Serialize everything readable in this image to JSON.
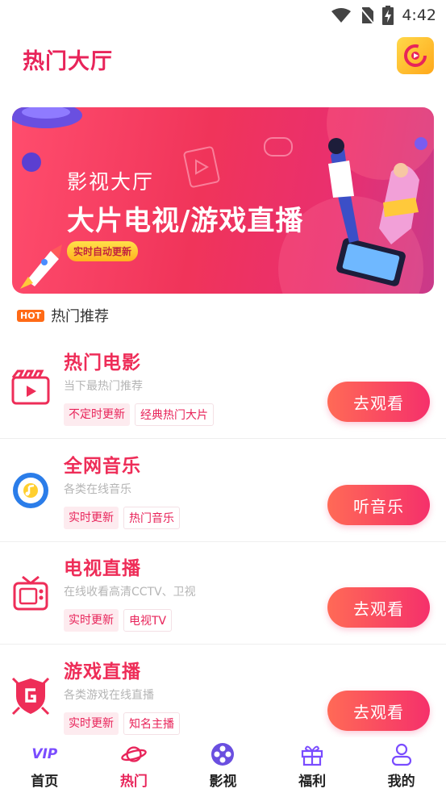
{
  "status_bar": {
    "time": "4:42",
    "icons": [
      "wifi-icon",
      "no-sim-icon",
      "battery-charging-icon"
    ]
  },
  "header": {
    "title": "热门大厅",
    "logo_icon": "app-logo-icon"
  },
  "banner": {
    "subtitle": "影视大厅",
    "title": "大片电视/游戏直播",
    "badge": "实时自动更新"
  },
  "section": {
    "hot_tag": "HOT",
    "label": "热门推荐"
  },
  "items": [
    {
      "title": "热门电影",
      "desc": "当下最热门推荐",
      "tags": [
        "不定时更新",
        "经典热门大片"
      ],
      "button": "去观看",
      "icon": "movie-clapper-icon"
    },
    {
      "title": "全网音乐",
      "desc": "各类在线音乐",
      "tags": [
        "实时更新",
        "热门音乐"
      ],
      "button": "听音乐",
      "icon": "music-disc-icon"
    },
    {
      "title": "电视直播",
      "desc": "在线收看高清CCTV、卫视",
      "tags": [
        "实时更新",
        "电视TV"
      ],
      "button": "去观看",
      "icon": "tv-icon"
    },
    {
      "title": "游戏直播",
      "desc": "各类游戏在线直播",
      "tags": [
        "实时更新",
        "知名主播"
      ],
      "button": "去观看",
      "icon": "game-shield-icon"
    }
  ],
  "nav": [
    {
      "label": "首页",
      "icon": "vip-icon",
      "icon_text": "VIP",
      "active": false
    },
    {
      "label": "热门",
      "icon": "planet-icon",
      "active": true
    },
    {
      "label": "影视",
      "icon": "film-reel-icon",
      "active": false
    },
    {
      "label": "福利",
      "icon": "gift-icon",
      "active": false
    },
    {
      "label": "我的",
      "icon": "user-icon",
      "active": false
    }
  ],
  "colors": {
    "accent": "#e8245a",
    "button_start": "#ff6a56",
    "button_end": "#f5306b",
    "logo": "#ffa81a"
  }
}
